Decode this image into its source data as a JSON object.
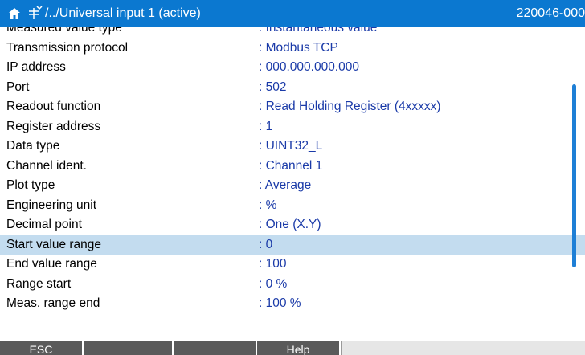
{
  "header": {
    "path": "/../Universal input 1 (active)",
    "device_id": "220046-000",
    "home_icon": "home-icon",
    "menu_icon": "config-menu-icon"
  },
  "rows": [
    {
      "label": "Measured value type",
      "value": ": Instantaneous value"
    },
    {
      "label": "Transmission protocol",
      "value": ": Modbus TCP"
    },
    {
      "label": "IP address",
      "value": ": 000.000.000.000"
    },
    {
      "label": "Port",
      "value": ": 502"
    },
    {
      "label": "Readout function",
      "value": ": Read Holding Register (4xxxxx)"
    },
    {
      "label": "Register address",
      "value": ": 1"
    },
    {
      "label": "Data type",
      "value": ": UINT32_L"
    },
    {
      "label": "Channel ident.",
      "value": ": Channel 1"
    },
    {
      "label": "Plot type",
      "value": ": Average"
    },
    {
      "label": "Engineering unit",
      "value": ": %"
    },
    {
      "label": "Decimal point",
      "value": ": One (X.Y)"
    },
    {
      "label": "Start value range",
      "value": ": 0",
      "selected": true
    },
    {
      "label": "End value range",
      "value": ": 100"
    },
    {
      "label": "Range start",
      "value": ": 0 %"
    },
    {
      "label": "Meas. range end",
      "value": ": 100 %"
    }
  ],
  "softkeys": {
    "esc": "ESC",
    "f2": "",
    "f3": "",
    "help": "Help"
  },
  "colors": {
    "title_bar": "#0b78d0",
    "value_text": "#1a3aa8",
    "selection": "#c3dcef",
    "softkey": "#5a5a5a"
  }
}
